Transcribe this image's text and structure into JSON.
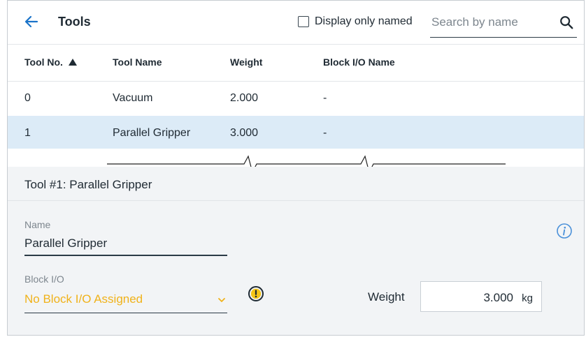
{
  "header": {
    "title": "Tools",
    "filter_label": "Display only named",
    "search_placeholder": "Search by name"
  },
  "table": {
    "columns": [
      "Tool No.",
      "Tool Name",
      "Weight",
      "Block I/O Name"
    ],
    "sorted_column": "Tool No.",
    "sort_direction": "ascending",
    "rows": [
      {
        "no": "0",
        "name": "Vacuum",
        "weight": "2.000",
        "block": "-",
        "selected": false
      },
      {
        "no": "1",
        "name": "Parallel Gripper",
        "weight": "3.000",
        "block": "-",
        "selected": true
      }
    ]
  },
  "detail": {
    "title": "Tool #1: Parallel Gripper",
    "name_label": "Name",
    "name_value": "Parallel Gripper",
    "block_label": "Block I/O",
    "block_value": "No Block I/O Assigned",
    "weight_label": "Weight",
    "weight_value": "3.000",
    "weight_unit": "kg"
  },
  "icons": {
    "back": "arrow-left-icon",
    "search": "search-icon",
    "info": "info-icon",
    "warning": "warning-icon",
    "chevron": "chevron-down-icon"
  },
  "colors": {
    "accent": "#1a73c9",
    "selected_row": "#dcebf7",
    "warning": "#f0b21a",
    "panel_bg": "#f2f4f6"
  }
}
